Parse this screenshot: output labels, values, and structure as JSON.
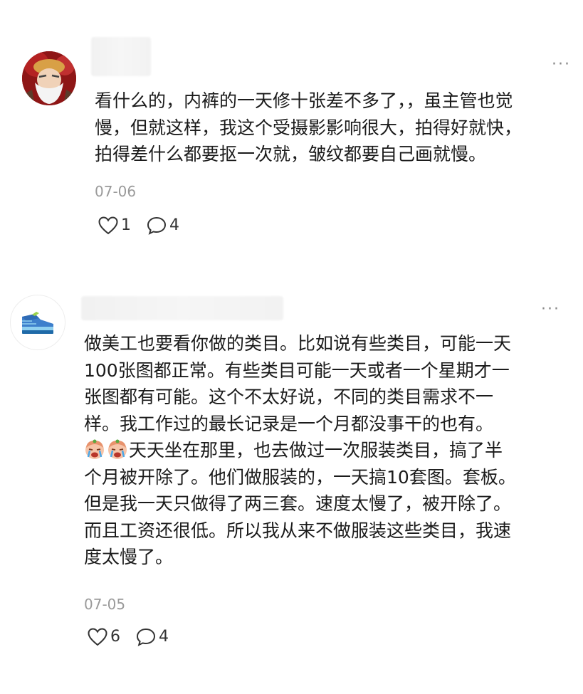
{
  "comments": [
    {
      "text_lines": [
        "看什么的，内裤的一天修十张差不多了，，虽主管也觉",
        "慢，但就这样，我这个受摄影影响很大，拍得好就快，",
        "拍得差什么都要抠一次就，皱纹都要自己画就慢。"
      ],
      "date": "07-06",
      "likes": "1",
      "replies": "4",
      "more_label": "···"
    },
    {
      "text_lines": [
        "做美工也要看你做的类目。比如说有些类目，可能一天",
        "100张图都正常。有些类目可能一天或者一个星期才一",
        "张图都有可能。这个不太好说，不同的类目需求不一",
        "样。我工作过的最长记录是一个月都没事干的也有。",
        "天天坐在那里，也去做过一次服装类目，搞了半",
        "个月被开除了。他们做服装的，一天搞10套图。套板。",
        "但是我一天只做得了两三套。速度太慢了，被开除了。",
        "而且工资还很低。所以我从来不做服装这些类目，我速",
        "度太慢了。"
      ],
      "emoji_names": [
        "crying-face-emoji",
        "crying-face-emoji"
      ],
      "date": "07-05",
      "likes": "6",
      "replies": "4",
      "more_label": "···"
    }
  ],
  "icons": {
    "like": "heart-outline-icon",
    "reply": "speech-bubble-icon",
    "more": "more-dots-icon"
  },
  "colors": {
    "text": "#1b1b1b",
    "date": "#9a9a9a",
    "icon": "#333333"
  }
}
